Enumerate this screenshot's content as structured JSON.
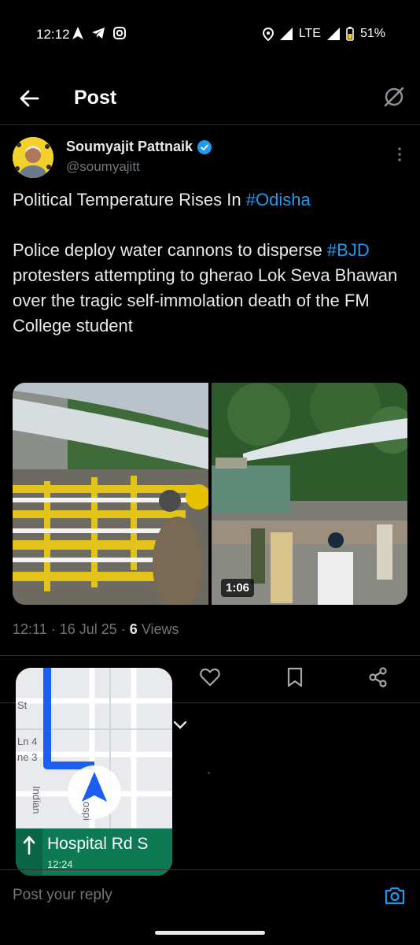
{
  "status_bar": {
    "time": "12:12",
    "network": "LTE",
    "battery": "51%"
  },
  "header": {
    "title": "Post"
  },
  "post": {
    "author_name": "Soumyajit Pattnaik",
    "author_handle": "@soumyajitt",
    "verified": true,
    "text_line1_prefix": "Political Temperature Rises In ",
    "text_line1_tag": "#Odisha",
    "text_para2_prefix": "Police deploy water cannons to disperse ",
    "text_para2_tag": "#BJD",
    "text_para2_suffix": " protesters attempting to gherao Lok Seva Bhawan over the tragic self-immolation death of the FM College student",
    "video_duration": "1:06",
    "time": "12:11",
    "date": "16 Jul 25",
    "views_count": "6",
    "views_label": "Views"
  },
  "navigation_pip": {
    "street": "Hospital Rd S",
    "eta": "12:24",
    "map_labels": [
      "St",
      "Ln 4",
      "ne 3",
      "Indian",
      "ospi"
    ]
  },
  "reply": {
    "placeholder": "Post your reply"
  },
  "colors": {
    "accent": "#1d9bf0",
    "nav_green": "#0d7a54",
    "route_blue": "#1a5ff0"
  }
}
